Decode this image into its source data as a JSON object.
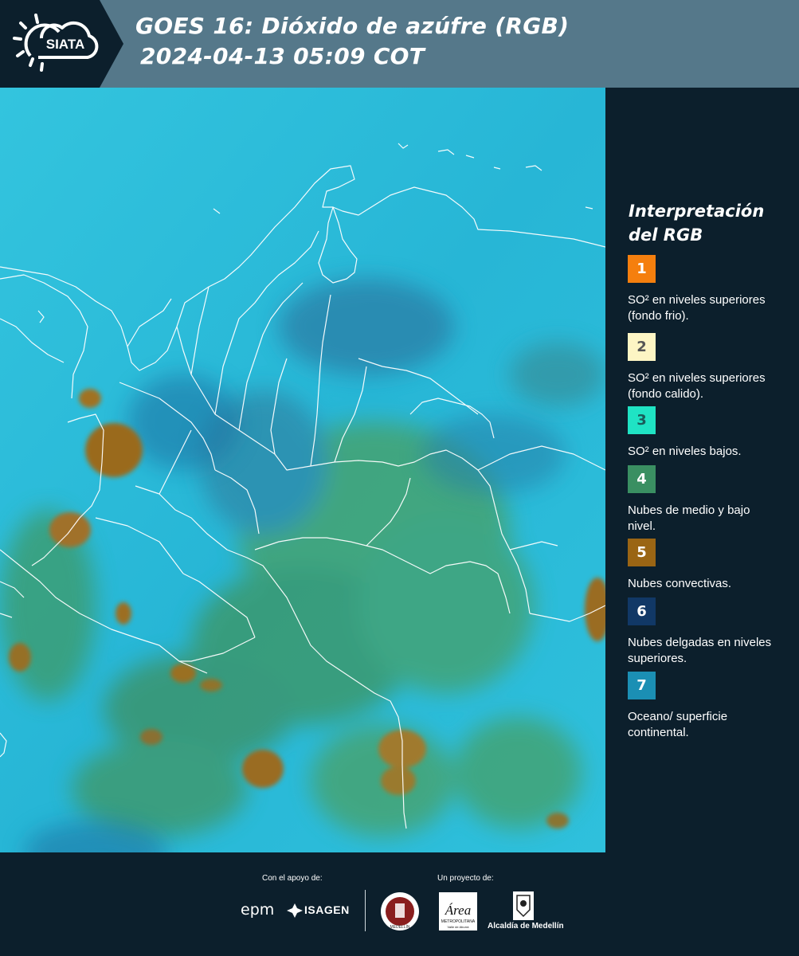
{
  "header": {
    "logo_text": "SIATA",
    "title_line1": "GOES 16: Dióxido de azúfre (RGB)",
    "title_line2": "2024-04-13 05:09 COT"
  },
  "legend": {
    "title": "Interpretación del RGB",
    "items": [
      {
        "number": "1",
        "color": "#f57f0e",
        "text_color": "#ffffff",
        "description": "SO² en niveles superiores (fondo frio)."
      },
      {
        "number": "2",
        "color": "#fdf5c4",
        "text_color": "#555555",
        "description": "SO² en niveles superiores (fondo calido)."
      },
      {
        "number": "3",
        "color": "#1fe3c4",
        "text_color": "#1a5c5a",
        "description": "SO² en niveles bajos."
      },
      {
        "number": "4",
        "color": "#3a8f62",
        "text_color": "#ffffff",
        "description": "Nubes de medio y bajo nivel."
      },
      {
        "number": "5",
        "color": "#9a6514",
        "text_color": "#ffffff",
        "description": "Nubes convectivas."
      },
      {
        "number": "6",
        "color": "#113866",
        "text_color": "#ffffff",
        "description": "Nubes delgadas en niveles superiores."
      },
      {
        "number": "7",
        "color": "#1b8fb4",
        "text_color": "#ffffff",
        "description": "Oceano/ superficie continental."
      }
    ]
  },
  "footer": {
    "support_label": "Con el apoyo de:",
    "project_label": "Un proyecto de:",
    "sponsors": {
      "epm": "epm",
      "isagen": "ISAGEN",
      "metropolitana_main": "Área",
      "metropolitana_sub": "METROPOLITANA",
      "metropolitana_sub2": "Valle de Aburrá",
      "alcaldia": "Alcaldía de Medellín",
      "medellin_seal": "MEDELLÍN"
    }
  },
  "colors": {
    "header_band": "#55788a",
    "panel_bg": "#0c1f2c",
    "ocean": "#2ab9d7",
    "land_green": "#4a9d5f",
    "convective": "#9a6a1c"
  }
}
